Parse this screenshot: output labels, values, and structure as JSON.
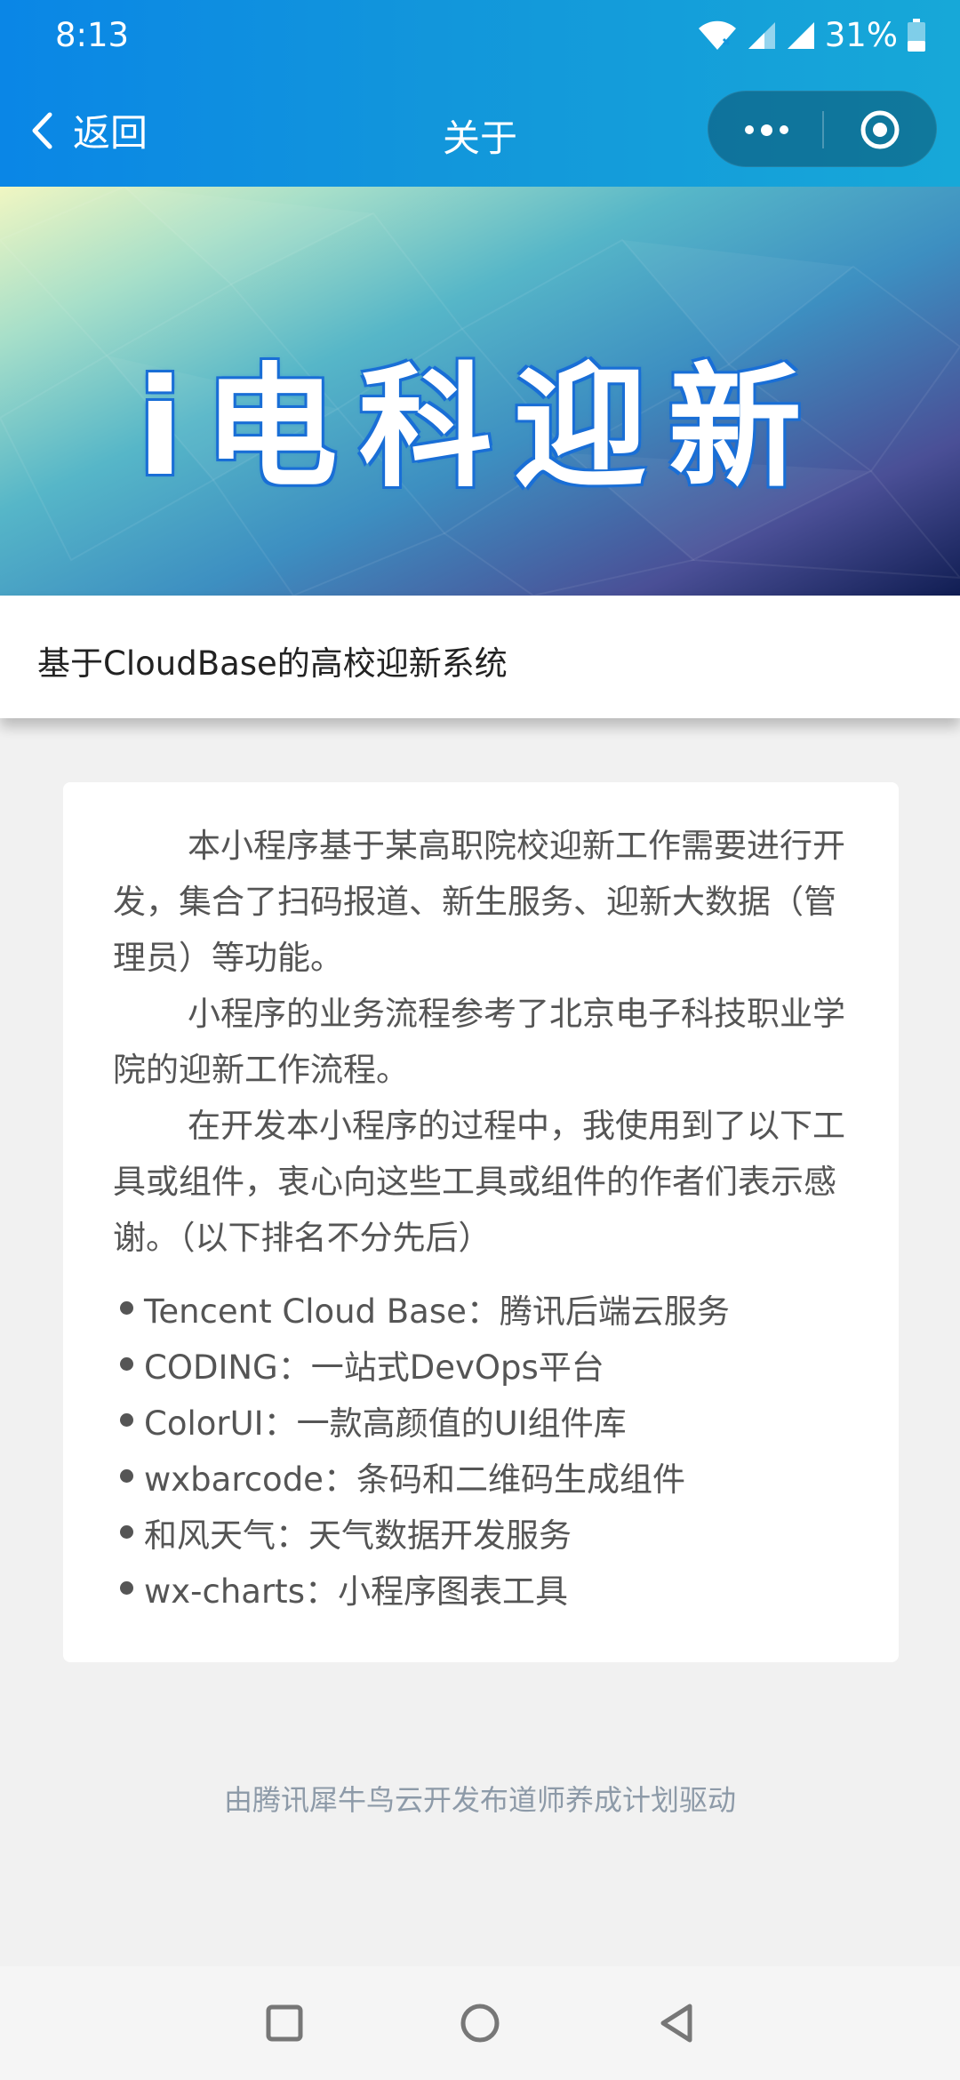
{
  "status_bar": {
    "time": "8:13",
    "battery_percent": "31%",
    "icons": [
      "wifi-icon",
      "cell-signal-icon",
      "cell-signal-icon",
      "battery-icon"
    ]
  },
  "nav": {
    "back_label": "返回",
    "title": "关于",
    "capsule_icons": [
      "more-icon",
      "close-mini-program-icon"
    ]
  },
  "banner": {
    "logo_text": "i电科迎新"
  },
  "subtitle": "基于CloudBase的高校迎新系统",
  "content": {
    "paragraphs": [
      "本小程序基于某高职院校迎新工作需要进行开发，集合了扫码报道、新生服务、迎新大数据（管理员）等功能。",
      "小程序的业务流程参考了北京电子科技职业学院的迎新工作流程。",
      "在开发本小程序的过程中，我使用到了以下工具或组件，衷心向这些工具或组件的作者们表示感谢。（以下排名不分先后）"
    ],
    "list": [
      "Tencent Cloud Base：腾讯后端云服务",
      "CODING：一站式DevOps平台",
      "ColorUI：一款高颜值的UI组件库",
      "wxbarcode：条码和二维码生成组件",
      "和风天气：天气数据开发服务",
      "wx-charts：小程序图表工具"
    ]
  },
  "footer_credit": "由腾讯犀牛鸟云开发布道师养成计划驱动",
  "system_nav": [
    "recents-icon",
    "home-icon",
    "back-icon"
  ],
  "colors": {
    "header": "#1296db",
    "page_bg": "#f1f1f1",
    "card_bg": "#ffffff",
    "body_text": "#555555",
    "credit_text": "#8d9aa8"
  }
}
